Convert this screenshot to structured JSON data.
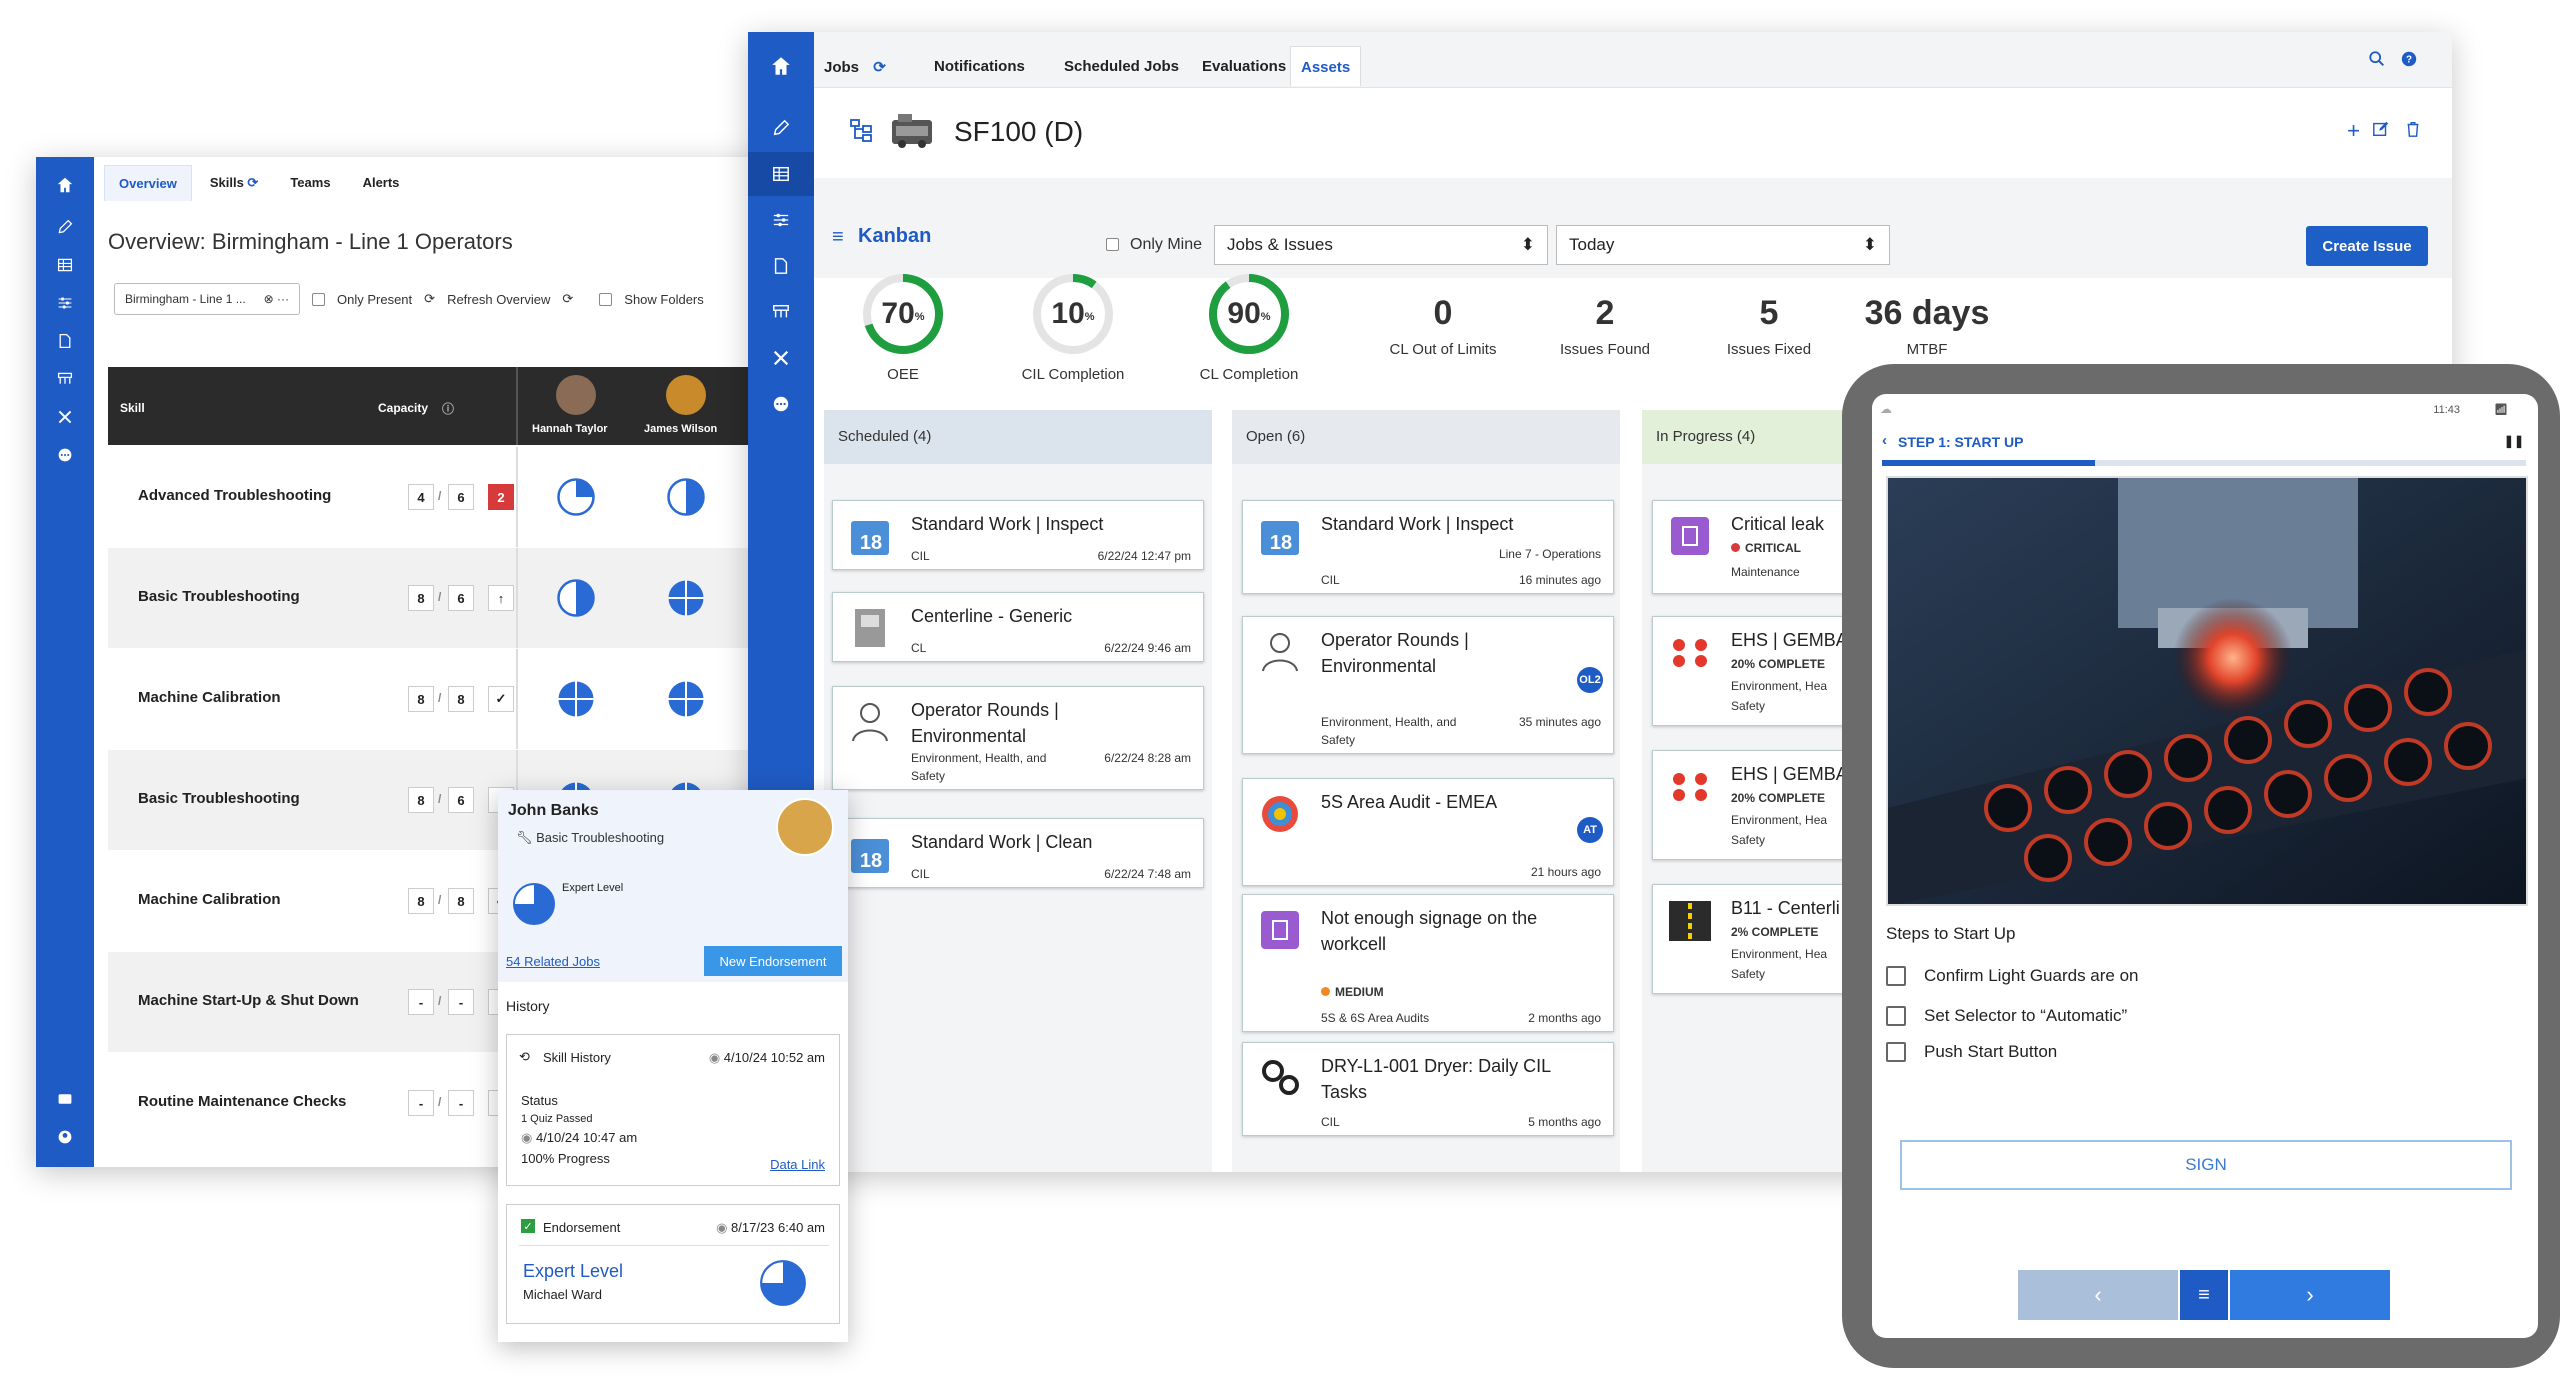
{
  "skills_window": {
    "tabs": [
      "Overview",
      "Skills",
      "Teams",
      "Alerts"
    ],
    "title": "Overview: Birmingham - Line 1 Operators",
    "filter_select": "Birmingham - Line 1 ...",
    "only_present": "Only Present",
    "refresh": "Refresh Overview",
    "show_folders": "Show Folders",
    "table_headers": {
      "skill": "Skill",
      "capacity": "Capacity"
    },
    "operators": [
      "Hannah Taylor",
      "James Wilson"
    ],
    "rows": [
      {
        "skill": "Advanced Troubleshooting",
        "a": "4",
        "b": "6",
        "status": "2"
      },
      {
        "skill": "Basic Troubleshooting",
        "a": "8",
        "b": "6",
        "status": "↑"
      },
      {
        "skill": "Machine Calibration",
        "a": "8",
        "b": "8",
        "status": "✓"
      },
      {
        "skill": "Basic Troubleshooting",
        "a": "8",
        "b": "6",
        "status": "↑"
      },
      {
        "skill": "Machine Calibration",
        "a": "8",
        "b": "8",
        "status": "✓"
      },
      {
        "skill": "Machine Start-Up & Shut Down",
        "a": "-",
        "b": "-",
        "status": ""
      },
      {
        "skill": "Routine Maintenance Checks",
        "a": "-",
        "b": "-",
        "status": ""
      }
    ]
  },
  "skill_popup": {
    "name": "John Banks",
    "skill": "Basic Troubleshooting",
    "level": "Expert Level",
    "related_jobs": "54 Related Jobs",
    "new_endorsement": "New Endorsement",
    "history_label": "History",
    "skill_history": {
      "title": "Skill History",
      "date": "4/10/24 10:52 am",
      "status_label": "Status",
      "quiz": "1 Quiz Passed",
      "quiz_date": "4/10/24 10:47 am",
      "progress": "100% Progress",
      "link": "Data Link"
    },
    "endorsement": {
      "title": "Endorsement",
      "date": "8/17/23 6:40 am",
      "level": "Expert Level",
      "by": "Michael Ward"
    }
  },
  "assets_window": {
    "tabs": [
      "Jobs",
      "Notifications",
      "Scheduled Jobs",
      "Evaluations",
      "Assets"
    ],
    "asset_title": "SF100 (D)",
    "kanban_label": "Kanban",
    "only_mine": "Only Mine",
    "filter_type": "Jobs & Issues",
    "filter_date": "Today",
    "create_issue": "Create Issue",
    "kpis": [
      {
        "value": "70",
        "unit": "%",
        "label": "OEE",
        "percent": 70
      },
      {
        "value": "10",
        "unit": "%",
        "label": "CIL Completion",
        "percent": 10
      },
      {
        "value": "90",
        "unit": "%",
        "label": "CL Completion",
        "percent": 90
      }
    ],
    "stats": [
      {
        "value": "0",
        "label": "CL Out of Limits"
      },
      {
        "value": "2",
        "label": "Issues Found"
      },
      {
        "value": "5",
        "label": "Issues Fixed"
      },
      {
        "value": "36 days",
        "label": "MTBF"
      }
    ],
    "columns": [
      {
        "title": "Scheduled (4)",
        "cards": [
          {
            "title": "Standard Work | Inspect",
            "type": "CIL",
            "time": "6/22/24 12:47 pm"
          },
          {
            "title": "Centerline - Generic",
            "type": "CL",
            "time": "6/22/24 9:46 am"
          },
          {
            "title": "Operator Rounds | Environmental",
            "type": "Environment, Health, and Safety",
            "time": "6/22/24 8:28 am"
          },
          {
            "title": "Standard Work | Clean",
            "type": "CIL",
            "time": "6/22/24 7:48 am"
          }
        ]
      },
      {
        "title": "Open (6)",
        "cards": [
          {
            "title": "Standard Work | Inspect",
            "type": "CIL",
            "loc": "Line 7 - Operations",
            "time": "16 minutes ago"
          },
          {
            "title": "Operator Rounds | Environmental",
            "type": "Environment, Health, and Safety",
            "badge": "OL2",
            "time": "35 minutes ago"
          },
          {
            "title": "5S Area Audit - EMEA",
            "type": "",
            "badge": "AT",
            "time": "21 hours ago"
          },
          {
            "title": "Not enough signage on the workcell",
            "priority": "MEDIUM",
            "type": "5S & 6S Area Audits",
            "time": "2 months ago"
          },
          {
            "title": "DRY-L1-001 Dryer: Daily CIL Tasks",
            "type": "CIL",
            "time": "5 months ago"
          }
        ]
      },
      {
        "title": "In Progress (4)",
        "cards": [
          {
            "title": "Critical leak",
            "priority": "CRITICAL",
            "type": "Maintenance"
          },
          {
            "title": "EHS | GEMBA",
            "progress": "20% COMPLETE",
            "type": "Environment, Hea",
            "type2": "Safety"
          },
          {
            "title": "EHS | GEMBA",
            "progress": "20% COMPLETE",
            "type": "Environment, Hea",
            "type2": "Safety"
          },
          {
            "title": "B11 - Centerli",
            "progress": "2% COMPLETE",
            "type": "Environment, Hea",
            "type2": "Safety"
          }
        ]
      }
    ]
  },
  "tablet": {
    "time": "11:43",
    "step": "STEP 1:  START UP",
    "progress": 0.33,
    "steps_title": "Steps to Start Up",
    "checks": [
      "Confirm Light Guards are on",
      "Set Selector to “Automatic”",
      "Push Start Button"
    ],
    "sign": "SIGN"
  },
  "colors": {
    "brand": "#1f5bc4",
    "green": "#1e9e3e",
    "red": "#d63a3a",
    "gray_bg": "#f3f4f6"
  }
}
